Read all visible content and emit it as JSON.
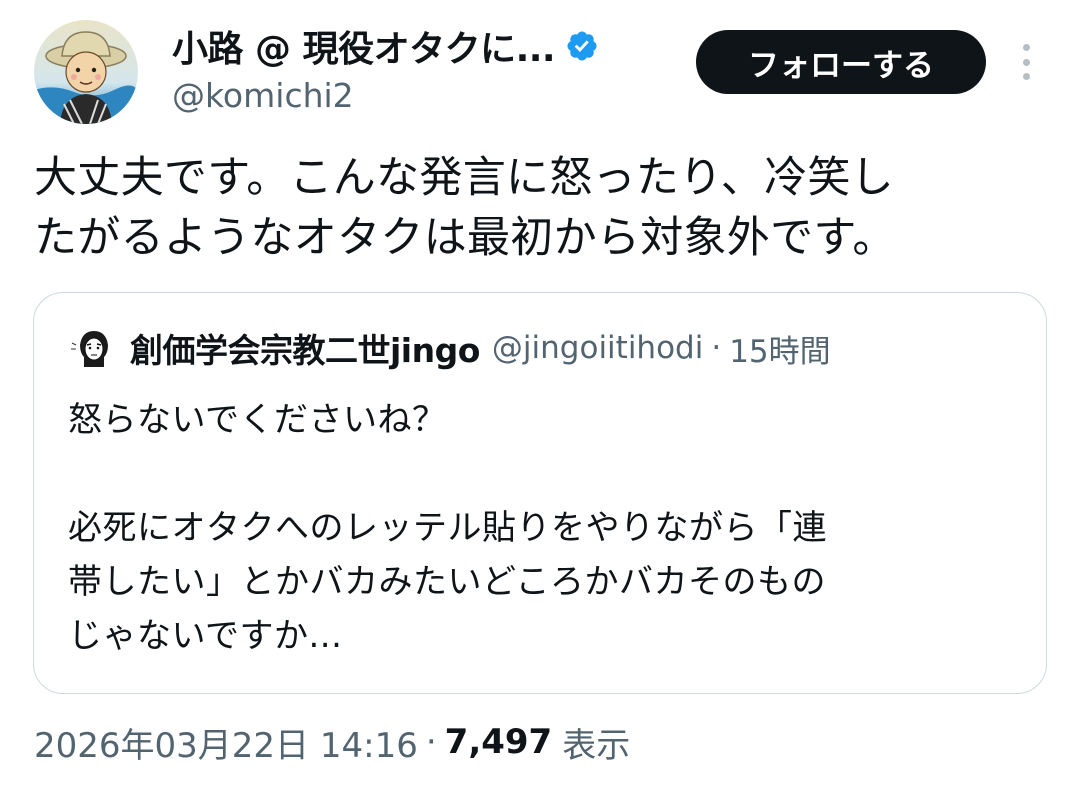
{
  "author": {
    "display_name": "小路 @ 現役オタクに...",
    "handle": "@komichi2",
    "verified_icon": "verified-badge-icon",
    "avatar_icon": "avatar-illustration"
  },
  "actions": {
    "follow_label": "フォローする",
    "more_icon": "more-vertical-icon"
  },
  "tweet": {
    "text": "大丈夫です。こんな発言に怒ったり、冷笑し\nたがるようなオタクは最初から対象外です。"
  },
  "quote": {
    "display_name": "創価学会宗教二世jingo",
    "handle": "@jingoiitihodi",
    "separator": "·",
    "time": "15時間",
    "text": "怒らないでくださいね？\n\n必死にオタクへのレッテル貼りをやりながら「連\n帯したい」とかバカみたいどころかバカそのもの\nじゃないですか..."
  },
  "meta": {
    "timestamp": "2026年03月22日 14:16",
    "separator": "·",
    "views_count": "7,497",
    "views_label": "表示"
  },
  "colors": {
    "text_primary": "#0f1419",
    "text_secondary": "#536471",
    "verified_blue": "#1d9bf0",
    "follow_bg": "#0f1419",
    "border": "#cfd9de"
  }
}
